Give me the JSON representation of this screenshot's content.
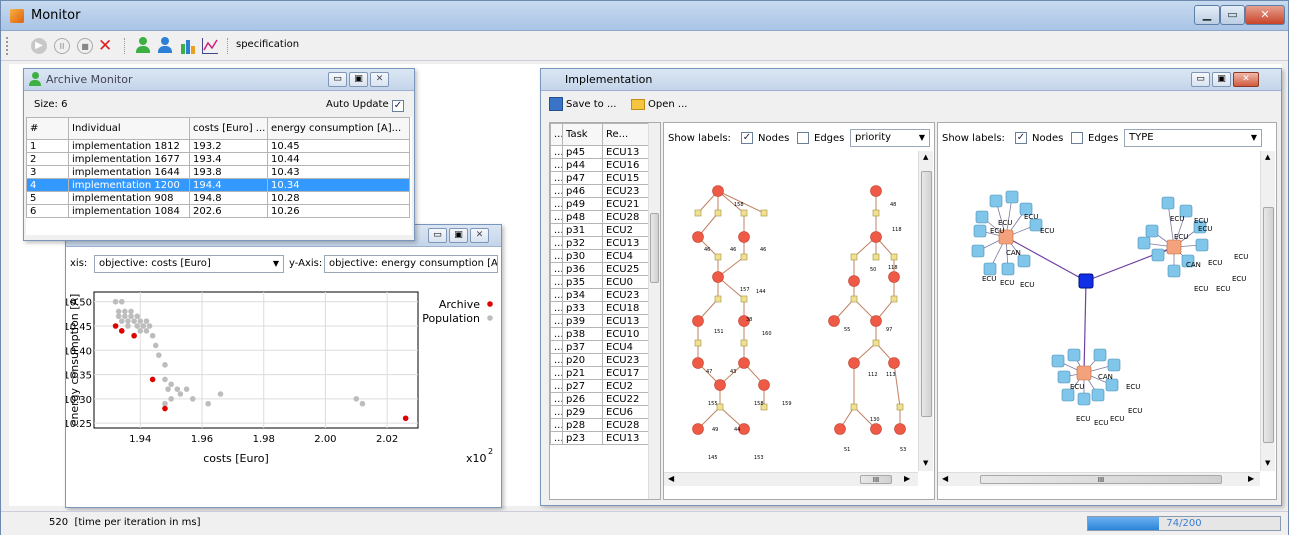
{
  "main": {
    "title": "Monitor"
  },
  "toolbar": {
    "specification_label": "specification"
  },
  "archive": {
    "title": "Archive Monitor",
    "size_label": "Size: 6",
    "auto_update_label": "Auto Update",
    "columns": [
      "#",
      "Individual",
      "costs [Euro] ...",
      "energy consumption [A]..."
    ],
    "rows": [
      [
        "1",
        "implementation 1812",
        "193.2",
        "10.45"
      ],
      [
        "2",
        "implementation 1677",
        "193.4",
        "10.44"
      ],
      [
        "3",
        "implementation 1644",
        "193.8",
        "10.43"
      ],
      [
        "4",
        "implementation 1200",
        "194.4",
        "10.34"
      ],
      [
        "5",
        "implementation 908",
        "194.8",
        "10.28"
      ],
      [
        "6",
        "implementation 1084",
        "202.6",
        "10.26"
      ]
    ],
    "selected_row": 3
  },
  "plot": {
    "x_axis_label": "xis:",
    "x_axis_value": "objective: costs [Euro]",
    "y_axis_label": "y-Axis:",
    "y_axis_value": "objective: energy consumption [A]",
    "legend_archive": "Archive",
    "legend_population": "Population",
    "xlabel": "costs [Euro]",
    "ylabel": "energy consumption [A]",
    "x_scale": "x10",
    "x_scale_exp": "2",
    "xticks": [
      "1.94",
      "1.96",
      "1.98",
      "2.00",
      "2.02"
    ],
    "yticks": [
      "10.50",
      "10.45",
      "10.40",
      "10.35",
      "10.30",
      "10.25"
    ],
    "archive_color": "#e00000",
    "population_color": "#bdbdbd"
  },
  "chart_data": {
    "type": "scatter",
    "xlabel": "costs [Euro]",
    "ylabel": "energy consumption [A]",
    "xlim": [
      1.925,
      2.03
    ],
    "ylim": [
      10.24,
      10.52
    ],
    "series": [
      {
        "name": "Archive",
        "points": [
          [
            1.932,
            10.45
          ],
          [
            1.934,
            10.44
          ],
          [
            1.938,
            10.43
          ],
          [
            1.944,
            10.34
          ],
          [
            1.948,
            10.28
          ],
          [
            2.026,
            10.26
          ]
        ]
      },
      {
        "name": "Population",
        "points": [
          [
            1.932,
            10.5
          ],
          [
            1.934,
            10.5
          ],
          [
            1.933,
            10.48
          ],
          [
            1.935,
            10.48
          ],
          [
            1.937,
            10.48
          ],
          [
            1.933,
            10.47
          ],
          [
            1.935,
            10.47
          ],
          [
            1.937,
            10.47
          ],
          [
            1.939,
            10.47
          ],
          [
            1.934,
            10.46
          ],
          [
            1.936,
            10.46
          ],
          [
            1.938,
            10.46
          ],
          [
            1.94,
            10.46
          ],
          [
            1.942,
            10.46
          ],
          [
            1.936,
            10.45
          ],
          [
            1.939,
            10.45
          ],
          [
            1.941,
            10.45
          ],
          [
            1.943,
            10.45
          ],
          [
            1.94,
            10.44
          ],
          [
            1.942,
            10.44
          ],
          [
            1.944,
            10.43
          ],
          [
            1.945,
            10.41
          ],
          [
            1.946,
            10.39
          ],
          [
            1.948,
            10.37
          ],
          [
            1.948,
            10.34
          ],
          [
            1.95,
            10.33
          ],
          [
            1.952,
            10.32
          ],
          [
            1.949,
            10.32
          ],
          [
            1.955,
            10.32
          ],
          [
            1.953,
            10.31
          ],
          [
            1.95,
            10.3
          ],
          [
            1.957,
            10.3
          ],
          [
            1.966,
            10.31
          ],
          [
            1.962,
            10.29
          ],
          [
            1.948,
            10.29
          ],
          [
            2.01,
            10.3
          ],
          [
            2.012,
            10.29
          ]
        ]
      }
    ]
  },
  "impl": {
    "title": "Implementation",
    "save_label": "Save to ...",
    "open_label": "Open ...",
    "table_cols": [
      "...",
      "Task",
      "Re..."
    ],
    "tasks": [
      [
        "p45",
        "ECU13"
      ],
      [
        "p44",
        "ECU16"
      ],
      [
        "p47",
        "ECU15"
      ],
      [
        "p46",
        "ECU23"
      ],
      [
        "p49",
        "ECU21"
      ],
      [
        "p48",
        "ECU28"
      ],
      [
        "p31",
        "ECU2"
      ],
      [
        "p32",
        "ECU13"
      ],
      [
        "p30",
        "ECU4"
      ],
      [
        "p36",
        "ECU25"
      ],
      [
        "p35",
        "ECU0"
      ],
      [
        "p34",
        "ECU23"
      ],
      [
        "p33",
        "ECU18"
      ],
      [
        "p39",
        "ECU13"
      ],
      [
        "p38",
        "ECU10"
      ],
      [
        "p37",
        "ECU4"
      ],
      [
        "p20",
        "ECU23"
      ],
      [
        "p21",
        "ECU17"
      ],
      [
        "p27",
        "ECU2"
      ],
      [
        "p26",
        "ECU22"
      ],
      [
        "p29",
        "ECU6"
      ],
      [
        "p28",
        "ECU28"
      ],
      [
        "p23",
        "ECU13"
      ]
    ],
    "ellipsis": "...",
    "show_labels": "Show labels:",
    "nodes_label": "Nodes",
    "edges_label": "Edges",
    "left_combo": "priority",
    "right_combo": "TYPE",
    "hscroll_thumb": "III"
  },
  "graph1": {
    "labels": [
      "158",
      "46",
      "46",
      "46",
      "157",
      "144",
      "38",
      "151",
      "160",
      "47",
      "43",
      "155",
      "158",
      "159",
      "49",
      "44",
      "145",
      "153"
    ]
  },
  "graph2": {
    "labels": [
      "48",
      "118",
      "50",
      "118",
      "55",
      "97",
      "112",
      "113",
      "130",
      "51",
      "53"
    ]
  },
  "graph3": {
    "ecu": "ECU",
    "can": "CAN"
  },
  "status": {
    "time_text": "520  [time per iteration in ms]",
    "progress_text": "74/200",
    "progress_fraction": 0.37
  }
}
